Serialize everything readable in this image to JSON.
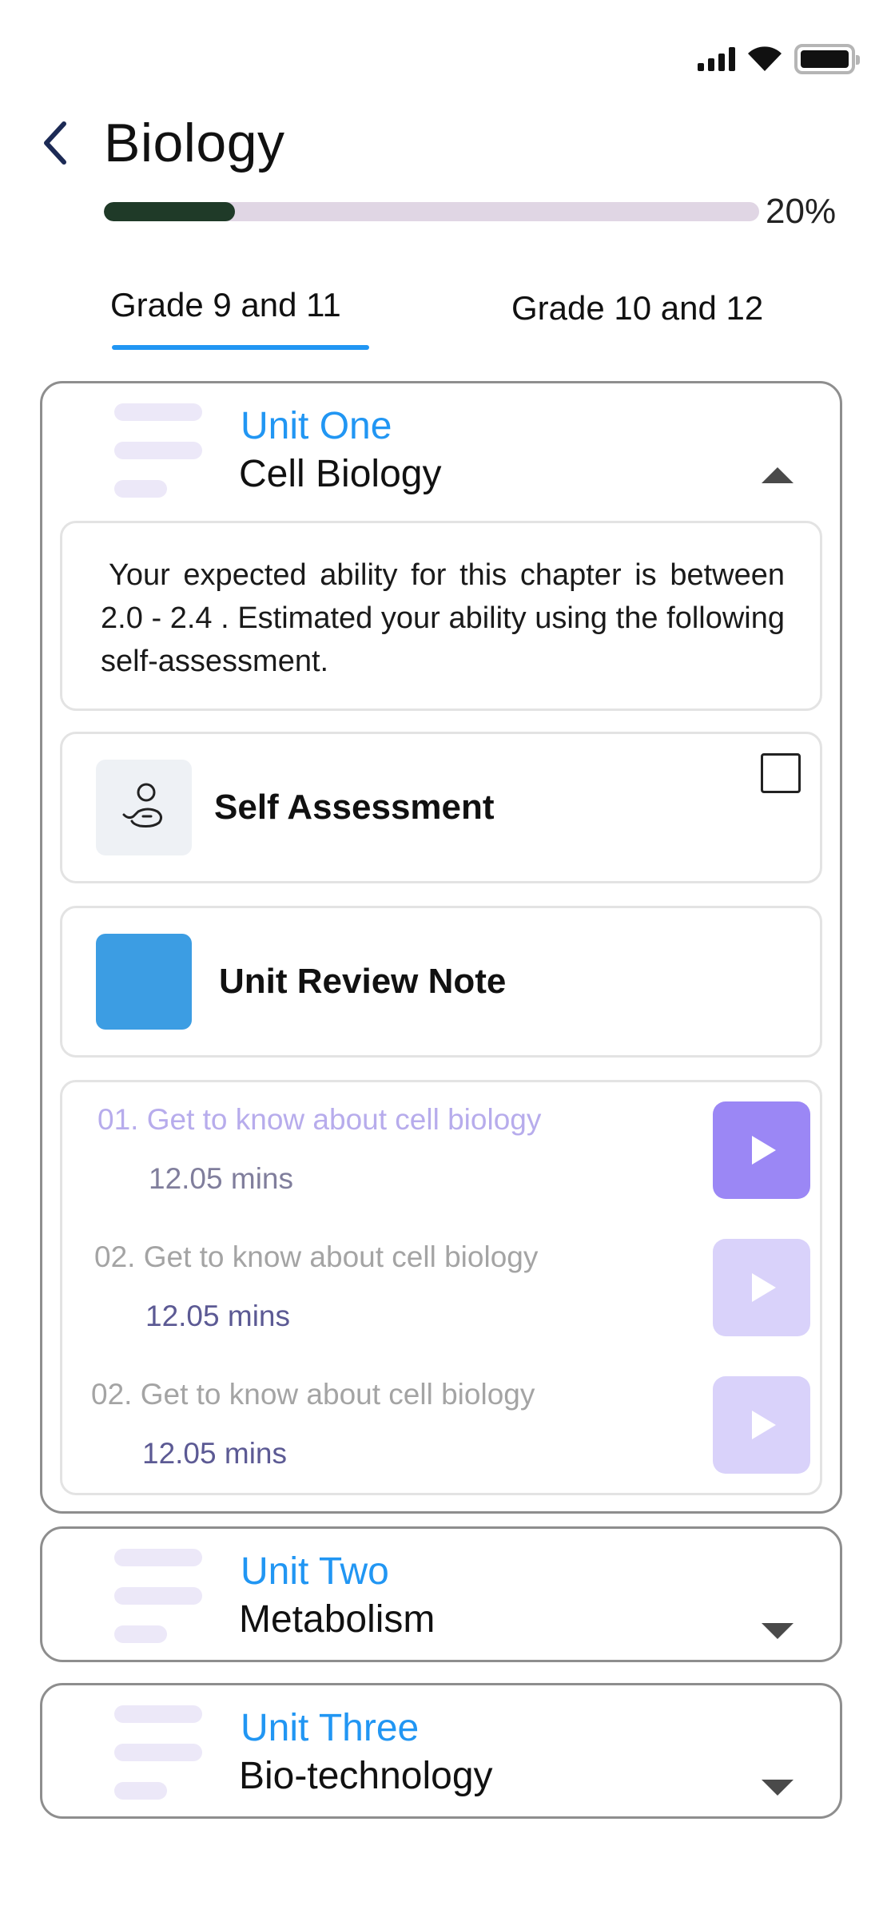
{
  "status_bar": {
    "signal_icon": "signal-icon",
    "wifi_icon": "wifi-icon",
    "battery_icon": "battery-icon"
  },
  "header": {
    "back_icon": "back-arrow-icon",
    "title": "Biology"
  },
  "progress": {
    "value": 0.2,
    "label": "20%"
  },
  "tabs": [
    {
      "label": "Grade 9 and 11",
      "active": true
    },
    {
      "label": "Grade 10 and 12",
      "active": false
    }
  ],
  "colors": {
    "accent": "#2196f3",
    "progress": "#1f3a28",
    "play_active": "#9b87f5",
    "play_muted": "#d9d2fa",
    "note_thumb": "#3c9de3"
  },
  "units": [
    {
      "label": "Unit One",
      "name": "Cell Biology",
      "expanded": true,
      "ability_text": "Your expected ability for this chapter is between 2.0 - 2.4 . Estimated your ability using the following self-assessment.",
      "self_assessment": {
        "label": "Self Assessment",
        "icon": "person-hand-icon",
        "checked": false
      },
      "review_note": {
        "label": "Unit Review Note"
      },
      "lessons": [
        {
          "title": "01. Get to know about cell biology",
          "duration": "12.05 mins"
        },
        {
          "title": "02. Get to know about cell biology",
          "duration": "12.05 mins"
        },
        {
          "title": "02. Get to know about cell biology",
          "duration": "12.05 mins"
        }
      ]
    },
    {
      "label": "Unit Two",
      "name": "Metabolism",
      "expanded": false
    },
    {
      "label": "Unit Three",
      "name": "Bio-technology",
      "expanded": false
    }
  ]
}
